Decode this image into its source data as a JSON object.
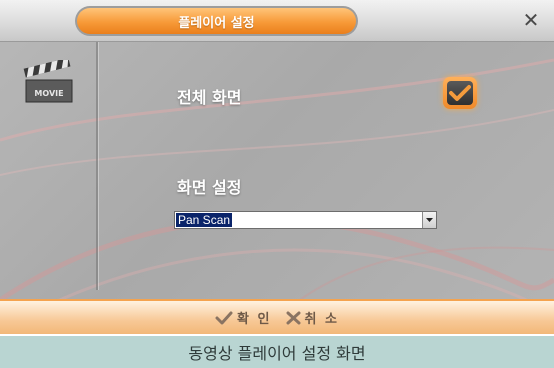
{
  "window": {
    "title": "플레이어 설정",
    "close_icon": "close-icon"
  },
  "side_panel": {
    "icon": "movie-clapper-icon",
    "icon_text": "MOVIE"
  },
  "settings": {
    "fullscreen_label": "전체 화면",
    "fullscreen_checked": true,
    "screen_setting_label": "화면 설정",
    "screen_setting_value": "Pan Scan"
  },
  "footer": {
    "confirm_label": "확 인",
    "cancel_label": "취 소"
  },
  "caption": "동영상 플레이어 설정 화면",
  "colors": {
    "accent_orange": "#f79a38",
    "caption_bg": "#b9d5d2",
    "selection_blue": "#0a246a"
  }
}
